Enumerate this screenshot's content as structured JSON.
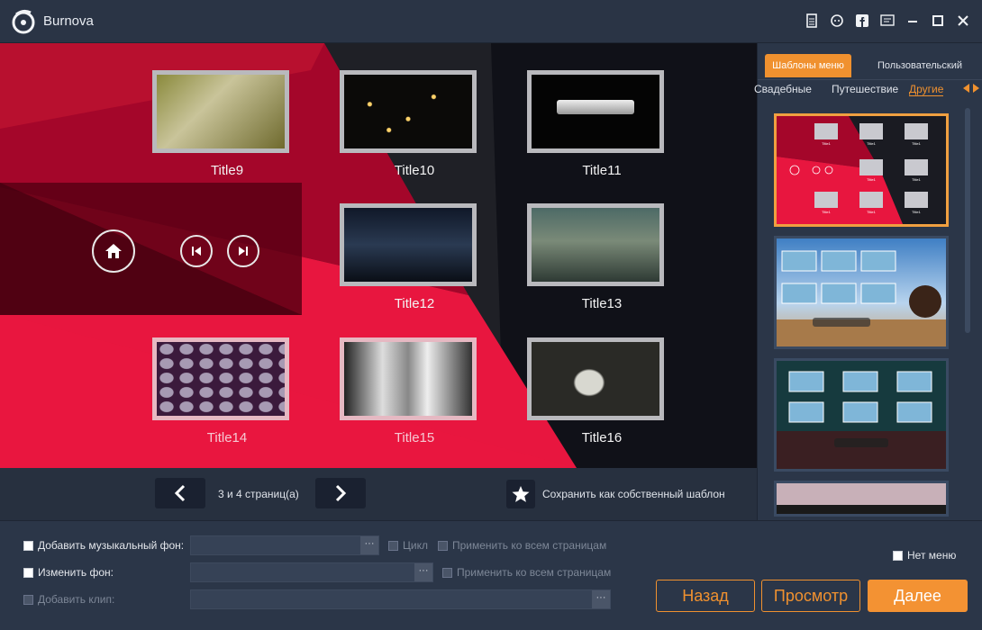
{
  "app": {
    "title": "Burnova"
  },
  "titlebar": {
    "icons": [
      "file-icon",
      "feedback-icon",
      "facebook-icon",
      "menu-list-icon",
      "minimize-icon",
      "maximize-icon",
      "close-icon"
    ]
  },
  "preview": {
    "titles": [
      {
        "label": "Title9"
      },
      {
        "label": "Title10"
      },
      {
        "label": "Title11"
      },
      {
        "label": "Title12"
      },
      {
        "label": "Title13"
      },
      {
        "label": "Title14"
      },
      {
        "label": "Title15"
      },
      {
        "label": "Title16"
      }
    ]
  },
  "pager": {
    "page_text": "3 и 4 страниц(а)",
    "save_template": "Сохранить как собственный шаблон"
  },
  "side": {
    "tabs": [
      "Шаблоны меню",
      "Пользовательский"
    ],
    "categories": [
      "Свадебные",
      "Путешествие",
      "Другие"
    ],
    "thumb_title": "Title1"
  },
  "options": {
    "music": "Добавить музыкальный фон:",
    "loop": "Цикл",
    "apply_all": "Применить ко всем страницам",
    "background": "Изменить фон:",
    "apply_all_bg": "Применить ко всем страницам",
    "clip": "Добавить клип:",
    "no_menu": "Нет меню",
    "dots": "···"
  },
  "buttons": {
    "back": "Назад",
    "preview": "Просмотр",
    "next": "Далее"
  },
  "colors": {
    "accent": "#f0912f",
    "crimson": "#b0102e",
    "pink": "#e8163f"
  }
}
